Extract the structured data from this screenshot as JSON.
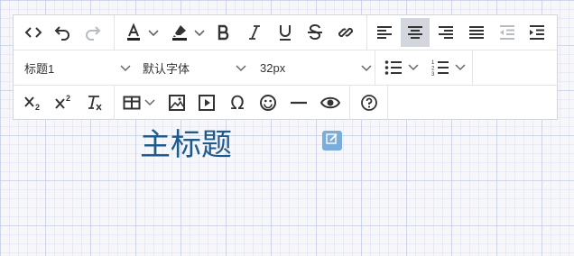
{
  "toolbar": {
    "row1": [
      {
        "icon": "code-view-icon"
      },
      {
        "icon": "undo-icon"
      },
      {
        "icon": "redo-icon"
      },
      {
        "icon": "font-color-icon"
      },
      {
        "icon": "highlight-color-icon"
      },
      {
        "icon": "bold-icon"
      },
      {
        "icon": "italic-icon"
      },
      {
        "icon": "underline-icon"
      },
      {
        "icon": "strikethrough-icon"
      },
      {
        "icon": "link-icon"
      },
      {
        "icon": "align-left-icon"
      },
      {
        "icon": "align-center-icon",
        "active": true
      },
      {
        "icon": "align-right-icon"
      },
      {
        "icon": "align-justify-icon"
      },
      {
        "icon": "outdent-icon"
      },
      {
        "icon": "indent-icon"
      }
    ],
    "heading_select": "标题1",
    "font_select": "默认字体",
    "size_select": "32px",
    "row2_icons": [
      "bulleted-list-icon",
      "numbered-list-icon"
    ],
    "row3": [
      {
        "icon": "subscript-icon",
        "label": "X₂"
      },
      {
        "icon": "superscript-icon",
        "label": "X²"
      },
      {
        "icon": "clear-format-icon"
      },
      {
        "icon": "table-icon"
      },
      {
        "icon": "image-icon"
      },
      {
        "icon": "video-icon"
      },
      {
        "icon": "special-char-icon",
        "label": "Ω"
      },
      {
        "icon": "emoji-icon"
      },
      {
        "icon": "horizontal-rule-icon"
      },
      {
        "icon": "preview-icon"
      },
      {
        "icon": "help-icon"
      }
    ]
  },
  "canvas": {
    "heading_text": "主标题",
    "edit_badge_icon": "edit-icon"
  },
  "colors": {
    "icon": "#333333",
    "icon_disabled": "#b8bcc2",
    "active_bg": "#d3d6dc",
    "heading": "#1e5a8c",
    "badge": "#7aaed9"
  }
}
